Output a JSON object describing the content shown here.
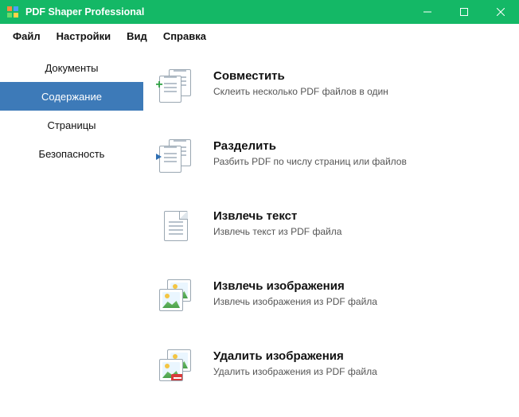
{
  "window": {
    "title": "PDF Shaper Professional"
  },
  "menu": {
    "file": "Файл",
    "settings": "Настройки",
    "view": "Вид",
    "help": "Справка"
  },
  "sidebar": {
    "items": [
      {
        "label": "Документы"
      },
      {
        "label": "Содержание"
      },
      {
        "label": "Страницы"
      },
      {
        "label": "Безопасность"
      }
    ],
    "active_index": 1
  },
  "actions": [
    {
      "title": "Совместить",
      "desc": "Склеить несколько PDF файлов в один"
    },
    {
      "title": "Разделить",
      "desc": "Разбить PDF по числу страниц или файлов"
    },
    {
      "title": "Извлечь текст",
      "desc": "Извлечь текст из PDF файла"
    },
    {
      "title": "Извлечь изображения",
      "desc": "Извлечь изображения из PDF файла"
    },
    {
      "title": "Удалить изображения",
      "desc": "Удалить изображения из PDF файла"
    }
  ]
}
